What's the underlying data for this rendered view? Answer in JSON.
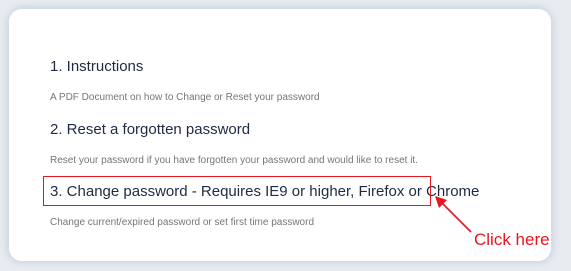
{
  "links": [
    {
      "title": "1. Instructions",
      "description": "A PDF Document on how to Change or Reset your password"
    },
    {
      "title": "2. Reset a forgotten password",
      "description": "Reset your password if you have forgotten your password and would like to reset it."
    },
    {
      "title": "3. Change password - Requires IE9 or higher, Firefox or Chrome",
      "description": "Change current/expired password or set first time password"
    }
  ],
  "annotation": {
    "callout_text": "Click here",
    "color": "#e8161f"
  },
  "colors": {
    "heading": "#1f2a44",
    "description": "#767676",
    "card_background": "#ffffff",
    "page_background": "#e8ecf1"
  }
}
